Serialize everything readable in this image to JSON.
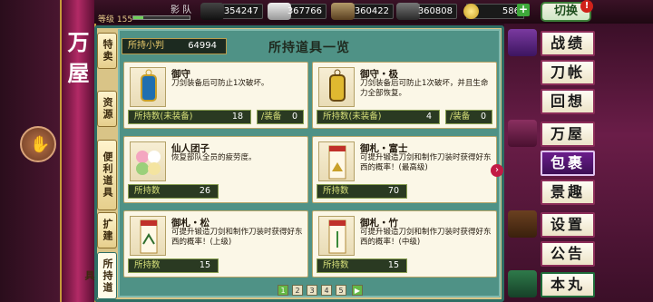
{
  "banner": {
    "title": "万屋"
  },
  "topbar": {
    "level_label": "等级 155",
    "level_fill": 0.18,
    "team_name": "影 队",
    "resources": [
      {
        "icon": "charcoal-icon",
        "value": "354247"
      },
      {
        "icon": "tamahagane-icon",
        "value": "367766"
      },
      {
        "icon": "cold-water-icon",
        "value": "360422"
      },
      {
        "icon": "whetstone-icon",
        "value": "360808"
      }
    ],
    "koban": "586",
    "plus": "+",
    "switch_label": "切换",
    "alert": "!"
  },
  "tabs": [
    "特卖",
    "资源",
    "便利道具",
    "扩建",
    "所持道具"
  ],
  "panel": {
    "koban_label": "所持小判",
    "koban_value": "64994",
    "title": "所持道具一览"
  },
  "items": [
    {
      "name": "御守",
      "desc": "刀剑装备后可防止1次破坏。",
      "count_label": "所持数(未装备)",
      "count_value": "18",
      "equip_label": "/装备",
      "equip_value": "0"
    },
    {
      "name": "御守・极",
      "desc": "刀剑装备后可防止1次破坏，并且生命力全部恢复。",
      "count_label": "所持数(未装备)",
      "count_value": "4",
      "equip_label": "/装备",
      "equip_value": "0"
    },
    {
      "name": "仙人团子",
      "desc": "恢复部队全员的疲劳度。",
      "count_label": "所持数",
      "count_value": "26"
    },
    {
      "name": "御札・富士",
      "desc": "可提升锻造刀剑和制作刀装时获得好东西的概率！(最高级)",
      "count_label": "所持数",
      "count_value": "70"
    },
    {
      "name": "御札・松",
      "desc": "可提升锻造刀剑和制作刀装时获得好东西的概率！(上级)",
      "count_label": "所持数",
      "count_value": "15"
    },
    {
      "name": "御札・竹",
      "desc": "可提升锻造刀剑和制作刀装时获得好东西的概率！(中级)",
      "count_label": "所持数",
      "count_value": "15"
    }
  ],
  "pager": [
    "1",
    "2",
    "3",
    "4",
    "5"
  ],
  "menu": [
    "战绩",
    "刀帐",
    "回想",
    "万屋",
    "包裹",
    "景趣",
    "设置",
    "公告",
    "本丸"
  ],
  "colors": {
    "accent": "#2e6e64",
    "banner": "#b22a66",
    "active_menu": "#6b1d8c"
  }
}
